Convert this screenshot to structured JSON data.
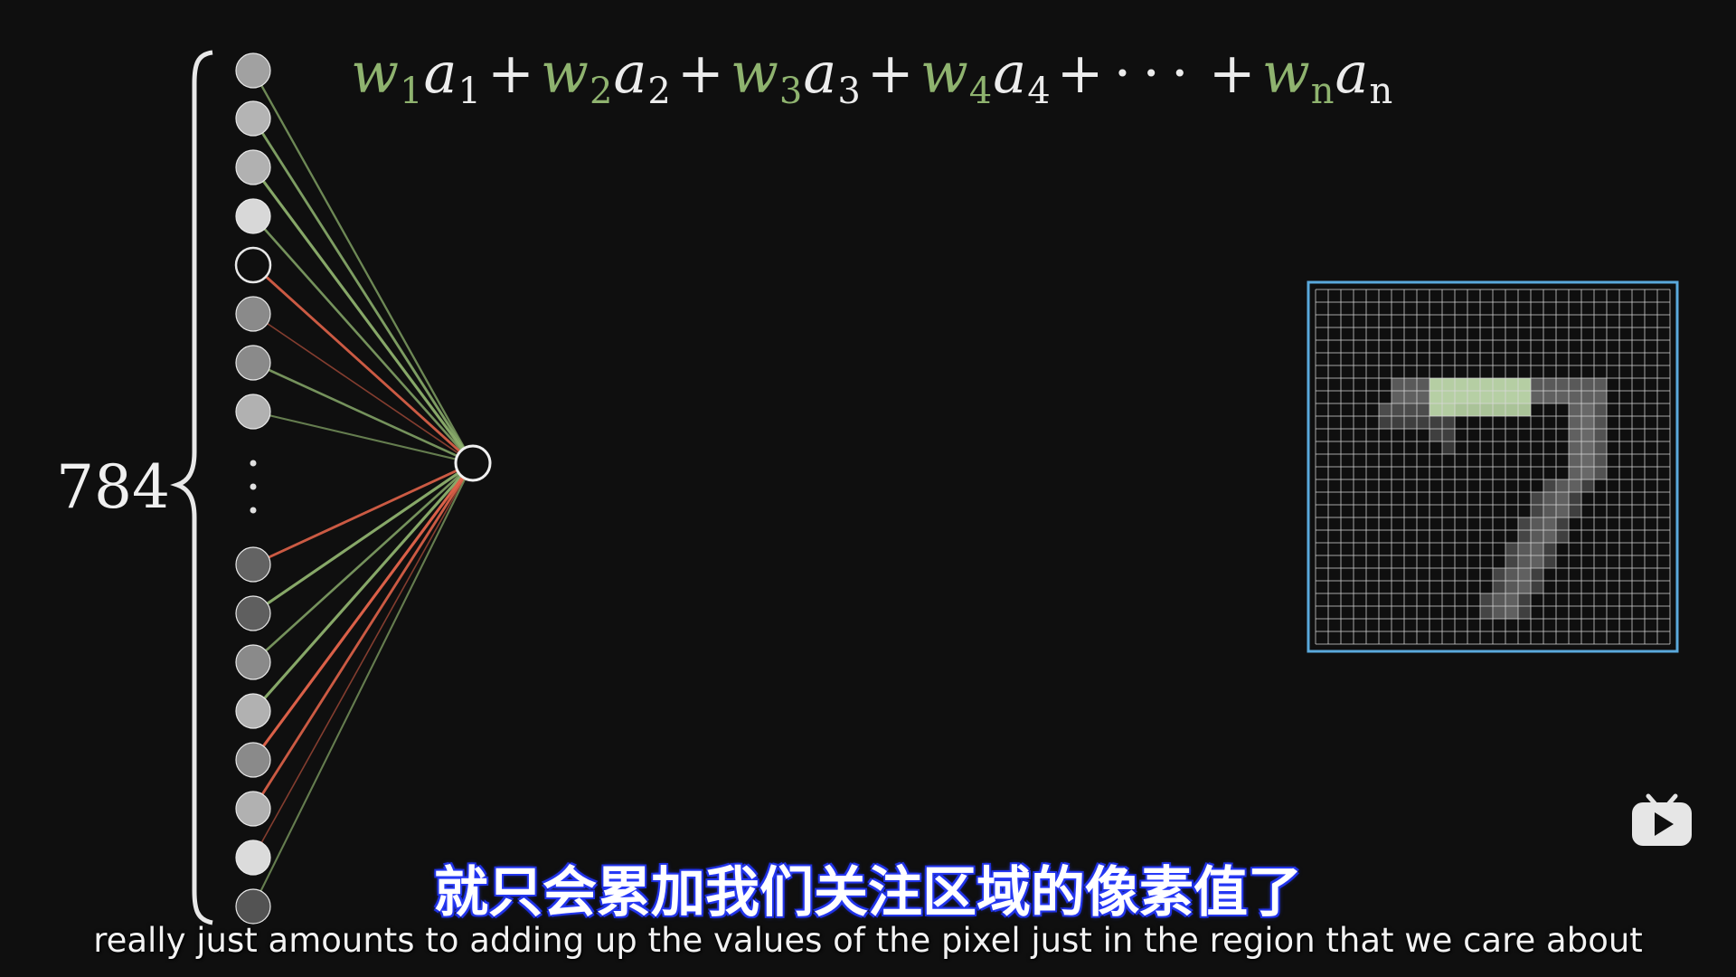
{
  "formula": {
    "terms": [
      {
        "w": "w",
        "ws": "1",
        "a": "a",
        "as": "1"
      },
      {
        "w": "w",
        "ws": "2",
        "a": "a",
        "as": "2"
      },
      {
        "w": "w",
        "ws": "3",
        "a": "a",
        "as": "3"
      },
      {
        "w": "w",
        "ws": "4",
        "a": "a",
        "as": "4"
      }
    ],
    "plus": "+",
    "dots": "···",
    "last": {
      "w": "w",
      "ws": "n",
      "a": "a",
      "as": "n"
    }
  },
  "input_layer": {
    "count_label": "784",
    "ellipsis": "⋮",
    "top_activations": [
      0.62,
      0.72,
      0.7,
      0.9,
      0.0,
      0.5,
      0.5,
      0.7
    ],
    "bottom_activations": [
      0.3,
      0.28,
      0.5,
      0.7,
      0.5,
      0.7,
      0.92,
      0.22
    ],
    "top_edges": [
      {
        "sign": "positive",
        "strength": 0.6
      },
      {
        "sign": "positive",
        "strength": 0.8
      },
      {
        "sign": "positive",
        "strength": 0.9
      },
      {
        "sign": "positive",
        "strength": 0.7
      },
      {
        "sign": "negative",
        "strength": 0.8
      },
      {
        "sign": "negative",
        "strength": 0.3
      },
      {
        "sign": "positive",
        "strength": 0.7
      },
      {
        "sign": "positive",
        "strength": 0.5
      }
    ],
    "bottom_edges": [
      {
        "sign": "negative",
        "strength": 0.8
      },
      {
        "sign": "positive",
        "strength": 0.9
      },
      {
        "sign": "positive",
        "strength": 0.7
      },
      {
        "sign": "positive",
        "strength": 0.9
      },
      {
        "sign": "negative",
        "strength": 0.9
      },
      {
        "sign": "negative",
        "strength": 0.8
      },
      {
        "sign": "negative",
        "strength": 0.3
      },
      {
        "sign": "positive",
        "strength": 0.5
      }
    ]
  },
  "digit_grid": {
    "size": 28,
    "digit": "7",
    "frame_color": "#5aa9dc",
    "highlight_color": "#c6e3b0",
    "stroke_color": "#8a8a8a"
  },
  "colors": {
    "positive": "#8fb36f",
    "negative": "#e8664c",
    "weight_text": "#8fb36f"
  },
  "subtitles": {
    "cn": "就只会累加我们关注区域的像素值了",
    "en": "really just amounts to adding up the values of the pixel just in the region that we care about"
  },
  "watermark": {
    "icon": "bilibili-tv-play-icon"
  }
}
